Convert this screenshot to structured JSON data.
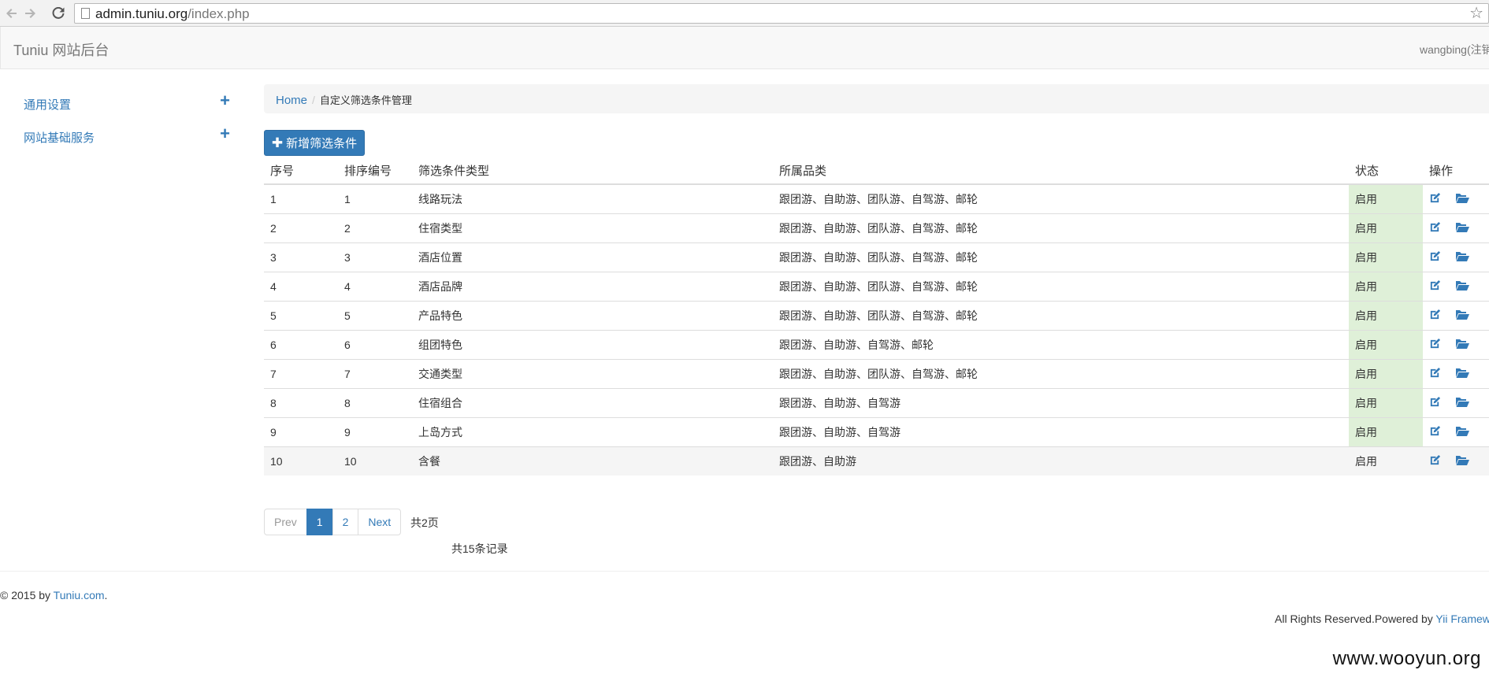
{
  "browser": {
    "url_host": "admin.tuniu.org",
    "url_path": "/index.php",
    "icons": [
      "back-arrow-icon",
      "forward-arrow-icon",
      "reload-icon",
      "page-icon",
      "star-icon"
    ]
  },
  "navbar": {
    "brand": "Tuniu 网站后台",
    "user": "wangbing(注销)"
  },
  "sidebar": {
    "items": [
      {
        "label": "通用设置",
        "icon": "plus-icon"
      },
      {
        "label": "网站基础服务",
        "icon": "plus-icon"
      }
    ]
  },
  "breadcrumb": {
    "home": "Home",
    "separator": "/",
    "current": "自定义筛选条件管理"
  },
  "toolbar": {
    "new_label": "新增筛选条件"
  },
  "table": {
    "headers": [
      "序号",
      "排序编号",
      "筛选条件类型",
      "所属品类",
      "状态",
      "操作"
    ],
    "rows": [
      {
        "id": "1",
        "order": "1",
        "type": "线路玩法",
        "category": "跟团游、自助游、团队游、自驾游、邮轮",
        "status": "启用"
      },
      {
        "id": "2",
        "order": "2",
        "type": "住宿类型",
        "category": "跟团游、自助游、团队游、自驾游、邮轮",
        "status": "启用"
      },
      {
        "id": "3",
        "order": "3",
        "type": "酒店位置",
        "category": "跟团游、自助游、团队游、自驾游、邮轮",
        "status": "启用"
      },
      {
        "id": "4",
        "order": "4",
        "type": "酒店品牌",
        "category": "跟团游、自助游、团队游、自驾游、邮轮",
        "status": "启用"
      },
      {
        "id": "5",
        "order": "5",
        "type": "产品特色",
        "category": "跟团游、自助游、团队游、自驾游、邮轮",
        "status": "启用"
      },
      {
        "id": "6",
        "order": "6",
        "type": "组团特色",
        "category": "跟团游、自助游、自驾游、邮轮",
        "status": "启用"
      },
      {
        "id": "7",
        "order": "7",
        "type": "交通类型",
        "category": "跟团游、自助游、团队游、自驾游、邮轮",
        "status": "启用"
      },
      {
        "id": "8",
        "order": "8",
        "type": "住宿组合",
        "category": "跟团游、自助游、自驾游",
        "status": "启用"
      },
      {
        "id": "9",
        "order": "9",
        "type": "上岛方式",
        "category": "跟团游、自助游、自驾游",
        "status": "启用"
      },
      {
        "id": "10",
        "order": "10",
        "type": "含餐",
        "category": "跟团游、自助游",
        "status": "启用"
      }
    ],
    "action_icons": [
      "edit-icon",
      "folder-open-icon"
    ]
  },
  "pagination": {
    "prev": "Prev",
    "pages": [
      "1",
      "2"
    ],
    "active_page": "1",
    "next": "Next",
    "total_pages": "共2页",
    "total_records": "共15条记录"
  },
  "footer": {
    "copyright_prefix": "© 2015 by ",
    "copyright_link": "Tuniu.com",
    "copyright_suffix": ".",
    "powered_prefix": "All Rights Reserved.Powered by ",
    "powered_link": "Yii Framework"
  },
  "watermark": "www.wooyun.org",
  "colors": {
    "primary": "#337ab7",
    "status_bg": "#dff0d8",
    "navbar_bg": "#f8f8f8"
  }
}
